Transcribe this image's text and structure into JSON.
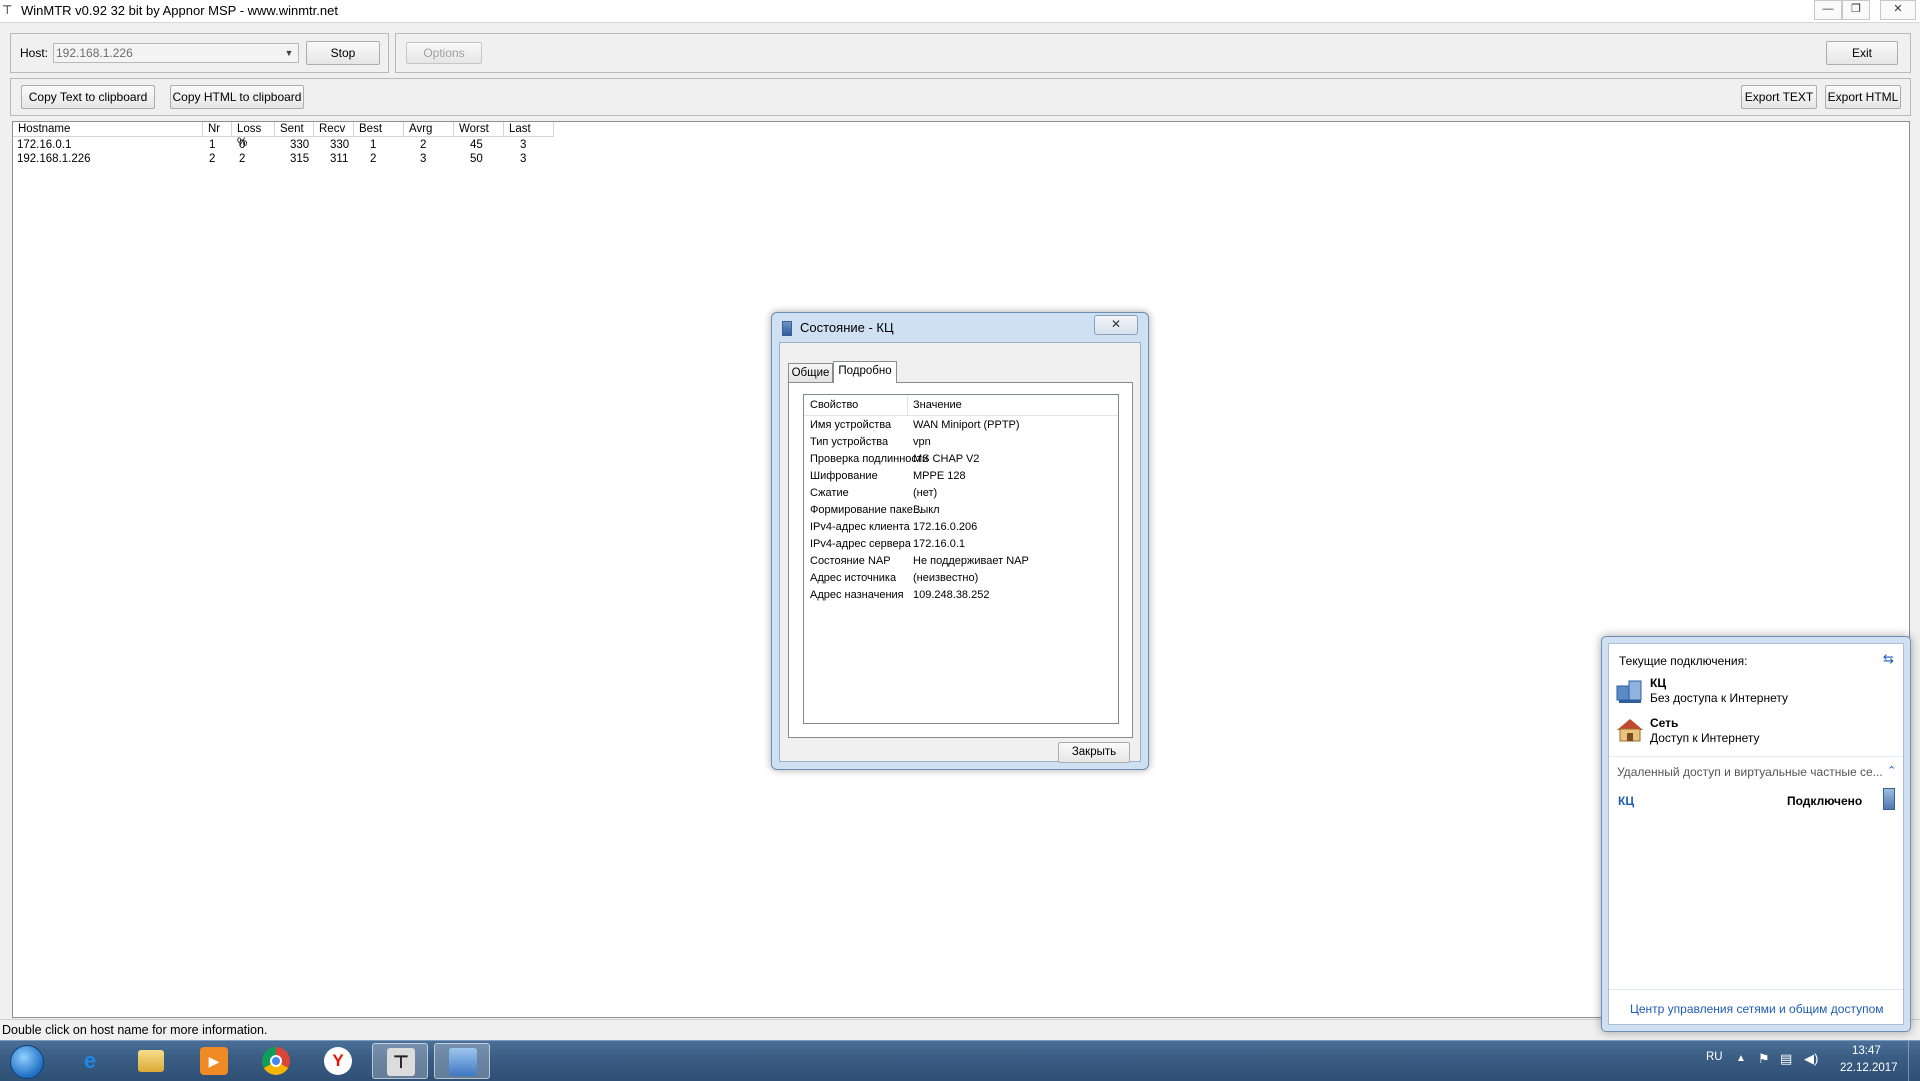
{
  "window": {
    "title": "WinMTR v0.92 32 bit by Appnor MSP - www.winmtr.net"
  },
  "toolbar": {
    "host_label": "Host:",
    "host_value": "192.168.1.226",
    "stop_label": "Stop",
    "options_label": "Options",
    "exit_label": "Exit",
    "copy_text_label": "Copy Text to clipboard",
    "copy_html_label": "Copy HTML to clipboard",
    "export_text_label": "Export TEXT",
    "export_html_label": "Export HTML"
  },
  "table": {
    "headers": [
      "Hostname",
      "Nr",
      "Loss %",
      "Sent",
      "Recv",
      "Best",
      "Avrg",
      "Worst",
      "Last"
    ],
    "rows": [
      [
        "172.16.0.1",
        "1",
        "0",
        "330",
        "330",
        "1",
        "2",
        "45",
        "3"
      ],
      [
        "192.168.1.226",
        "2",
        "2",
        "315",
        "311",
        "2",
        "3",
        "50",
        "3"
      ]
    ]
  },
  "statusbar": {
    "text": "Double click on host name for more information."
  },
  "dialog": {
    "title": "Состояние - КЦ",
    "close_glyph": "✕",
    "tabs": [
      "Общие",
      "Подробно"
    ],
    "columns": [
      "Свойство",
      "Значение"
    ],
    "properties": [
      [
        "Имя устройства",
        "WAN Miniport (PPTP)"
      ],
      [
        "Тип устройства",
        "vpn"
      ],
      [
        "Проверка подлинности",
        "MS CHAP V2"
      ],
      [
        "Шифрование",
        "MPPE 128"
      ],
      [
        "Сжатие",
        "(нет)"
      ],
      [
        "Формирование паке...",
        "Выкл"
      ],
      [
        "IPv4-адрес клиента",
        "172.16.0.206"
      ],
      [
        "IPv4-адрес сервера",
        "172.16.0.1"
      ],
      [
        "Состояние NAP",
        "Не поддерживает NAP"
      ],
      [
        "Адрес источника",
        "(неизвестно)"
      ],
      [
        "Адрес назначения",
        "109.248.38.252"
      ]
    ],
    "close_button": "Закрыть"
  },
  "network_popup": {
    "header": "Текущие подключения:",
    "connections": [
      {
        "name": "КЦ",
        "status": "Без доступа к Интернету"
      },
      {
        "name": "Сеть",
        "status": "Доступ к Интернету"
      }
    ],
    "section": "Удаленный доступ и виртуальные частные се...",
    "vpn_name": "КЦ",
    "vpn_status": "Подключено",
    "footer_link": "Центр управления сетями и общим доступом"
  },
  "taskbar": {
    "language": "RU",
    "time": "13:47",
    "date": "22.12.2017",
    "yandex_glyph": "Y"
  },
  "colors": {
    "taskbar": "#3b5d84",
    "link": "#1e5bb5",
    "dialog_frame": "#cfe0f2"
  }
}
